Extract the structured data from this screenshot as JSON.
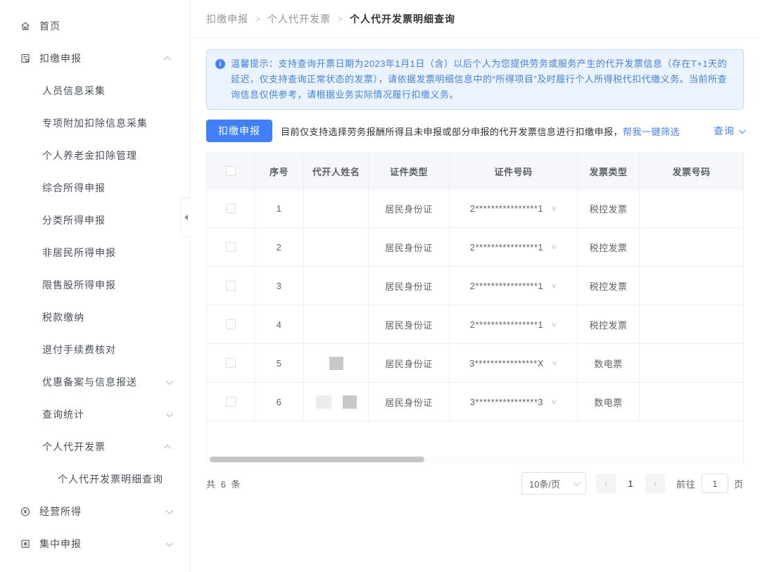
{
  "sidebar": {
    "items": [
      {
        "label": "首页"
      },
      {
        "label": "扣缴申报"
      },
      {
        "label": "人员信息采集"
      },
      {
        "label": "专项附加扣除信息采集"
      },
      {
        "label": "个人养老金扣除管理"
      },
      {
        "label": "综合所得申报"
      },
      {
        "label": "分类所得申报"
      },
      {
        "label": "非居民所得申报"
      },
      {
        "label": "限售股所得申报"
      },
      {
        "label": "税款缴纳"
      },
      {
        "label": "退付手续费核对"
      },
      {
        "label": "优惠备案与信息报送"
      },
      {
        "label": "查询统计"
      },
      {
        "label": "个人代开发票"
      },
      {
        "label": "个人代开发票明细查询"
      },
      {
        "label": "经营所得"
      },
      {
        "label": "集中申报"
      }
    ]
  },
  "breadcrumb": {
    "items": [
      "扣缴申报",
      "个人代开发票",
      "个人代开发票明细查询"
    ],
    "separator": ">"
  },
  "notice": {
    "icon": "i",
    "text": "温馨提示：支持查询开票日期为2023年1月1日（含）以后个人为您提供劳务或服务产生的代开发票信息（存在T+1天的延迟，仅支持查询正常状态的发票），请依据发票明细信息中的“所得项目”及时履行个人所得税代扣代缴义务。当前所查询信息仅供参考，请根据业务实际情况履行扣缴义务。"
  },
  "toolbar": {
    "declare_button": "扣缴申报",
    "hint": "目前仅支持选择劳务报酬所得且未申报或部分申报的代开发票信息进行扣缴申报，",
    "filter_link": "帮我一键筛选",
    "query_label": "查询"
  },
  "table": {
    "headers": [
      "序号",
      "代开人姓名",
      "证件类型",
      "证件号码",
      "发票类型",
      "发票号码"
    ],
    "rows": [
      {
        "seq": "1",
        "name": "",
        "cert_type": "居民身份证",
        "cert_no": "2****************1",
        "invoice_type": "税控发票",
        "invoice_no": ""
      },
      {
        "seq": "2",
        "name": "",
        "cert_type": "居民身份证",
        "cert_no": "2****************1",
        "invoice_type": "税控发票",
        "invoice_no": ""
      },
      {
        "seq": "3",
        "name": "",
        "cert_type": "居民身份证",
        "cert_no": "2****************1",
        "invoice_type": "税控发票",
        "invoice_no": ""
      },
      {
        "seq": "4",
        "name": "",
        "cert_type": "居民身份证",
        "cert_no": "2****************1",
        "invoice_type": "税控发票",
        "invoice_no": ""
      },
      {
        "seq": "5",
        "name": "",
        "cert_type": "居民身份证",
        "cert_no": "3****************X",
        "invoice_type": "数电票",
        "invoice_no": ""
      },
      {
        "seq": "6",
        "name": "",
        "cert_type": "居民身份证",
        "cert_no": "3****************3",
        "invoice_type": "数电票",
        "invoice_no": ""
      }
    ]
  },
  "pagination": {
    "total": "共 6 条",
    "page_size": "10条/页",
    "prev": "‹",
    "next": "›",
    "current_page": "1",
    "goto_label": "前往",
    "goto_value": "1",
    "page_unit": "页"
  },
  "colors": {
    "primary": "#4080ff",
    "notice_bg": "#eaf3ff",
    "notice_text": "#4381e6"
  }
}
